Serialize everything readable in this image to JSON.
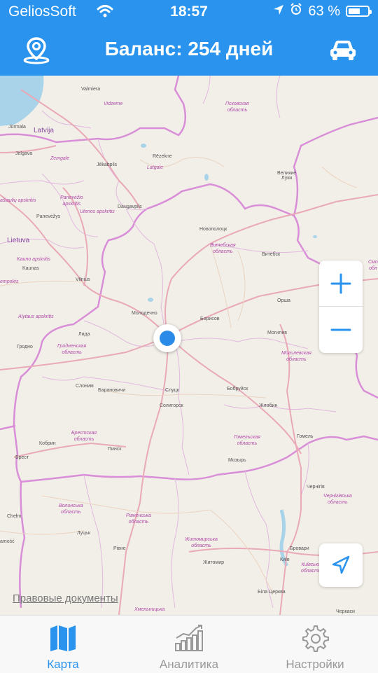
{
  "status_bar": {
    "carrier": "GeliosSoft",
    "time": "18:57",
    "battery": "63 %",
    "battery_level": 0.63
  },
  "navbar": {
    "title": "Баланс: 254 дней",
    "left_icon": "map-pin-icon",
    "right_icon": "car-icon"
  },
  "map": {
    "legal_link": "Правовые документы",
    "labels": {
      "valmiera": "Valmiera",
      "vidzeme": "Vidzeme",
      "pskov_obl": "Псковская\nобласть",
      "jurmala": "Jūrmala",
      "latvija": "Latvija",
      "jelgava": "Jelgava",
      "zemgale": "Zemgale",
      "jekabpils": "Jēkabpils",
      "rezekne": "Rēzekne",
      "latgale": "Latgale",
      "velikie_luki": "Великие\nЛуки",
      "siauliai": "ašiaulių apskritis",
      "panevezys_apskr": "Panevėžio\napskritis",
      "daugavpils": "Daugavpils",
      "panevezys": "Panevėžys",
      "utena": "Utenos apskritis",
      "novopolotsk": "Новополоцк",
      "lietuva": "Lietuva",
      "vitebsk_obl": "Витебская\nобласть",
      "vitebsk": "Витебск",
      "kaunas_apskr": "Kauno apskritis",
      "kaunas": "Kaunas",
      "vilnius": "Vilnius",
      "empoles": "empolės",
      "sm_obl": "Смо\nобл",
      "orsha": "Орша",
      "alytus": "Alytaus apskritis",
      "molodechno": "Молодечно",
      "borisov": "Борисов",
      "lida": "Лида",
      "mogilev": "Могилев",
      "grodno_obl": "Гродненская\nобласть",
      "grodno": "Гродно",
      "mogilev_obl": "Могилевская\nобласть",
      "slonim": "Слоним",
      "baranovichi": "Барановичи",
      "slutsk": "Слуцк",
      "bobruisk": "Бобруйск",
      "soligorsk": "Солигорск",
      "zhlobin": "Жлобин",
      "kobrin": "Кобрин",
      "brest_obl": "Брестская\nобласть",
      "gomel_obl": "Гомельская\nобласть",
      "gomel": "Гомель",
      "brest": "Брест",
      "pinsk": "Пинск",
      "mozyr": "Мозырь",
      "chernihiv": "Чернігів",
      "chernihiv_obl": "Чернігівська\nобласть",
      "volyn_obl": "Волинська\nобласть",
      "rivne_obl": "Рівненська\nобласть",
      "chelm": "Chełm",
      "lutsk": "Луцьк",
      "rivne": "Рівне",
      "zhytomyr_obl": "Житомирська\nобласть",
      "brovary": "Бровари",
      "kyiv": "Київ",
      "kyiv_obl": "Київська\nобласть",
      "zhytomyr": "Житомир",
      "zamosc": "amość",
      "bila_tserkva": "Біла Церква",
      "khmelnytska": "Хмельницька",
      "cherkasy": "Черкаси"
    }
  },
  "controls": {
    "zoom_in": "+",
    "zoom_out": "−",
    "locate_icon": "navigation-arrow-icon"
  },
  "tabs": [
    {
      "label": "Карта",
      "icon": "map-icon",
      "active": true
    },
    {
      "label": "Аналитика",
      "icon": "chart-icon",
      "active": false
    },
    {
      "label": "Настройки",
      "icon": "gear-icon",
      "active": false
    }
  ],
  "colors": {
    "accent": "#2a93ee",
    "map_bg": "#f2efe8",
    "border": "#d98ed8",
    "water": "#a9d3e9"
  }
}
